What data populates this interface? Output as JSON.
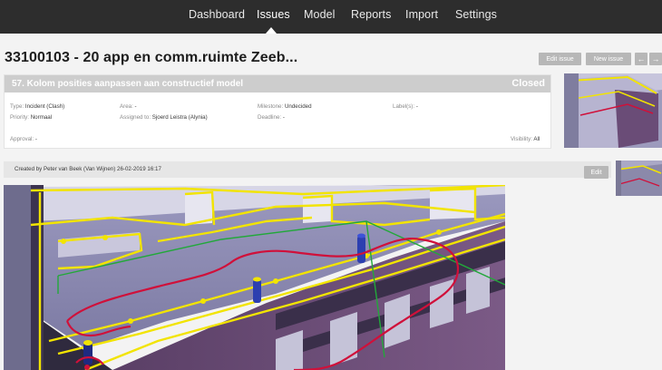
{
  "nav": {
    "items": [
      {
        "label": "Dashboard"
      },
      {
        "label": "Issues"
      },
      {
        "label": "Model"
      },
      {
        "label": "Reports"
      },
      {
        "label": "Import"
      },
      {
        "label": "Settings"
      }
    ]
  },
  "project": {
    "title": "33100103 - 20 app en comm.ruimte Zeeb..."
  },
  "toolbar": {
    "edit_issue": "Edit issue",
    "new_issue": "New issue",
    "prev_icon": "←",
    "next_icon": "→"
  },
  "issue": {
    "title": "57.  Kolom posities aanpassen aan constructief model",
    "status": "Closed",
    "fields": {
      "type_label": "Type:",
      "type_value": "Incident (Clash)",
      "priority_label": "Priority:",
      "priority_value": "Normaal",
      "area_label": "Area:",
      "area_value": "-",
      "assigned_label": "Assigned to:",
      "assigned_value": "Sjoerd Leistra (Alynia)",
      "milestone_label": "Milestone:",
      "milestone_value": "Undecided",
      "deadline_label": "Deadline:",
      "deadline_value": "-",
      "labels_label": "Label(s):",
      "labels_value": "-",
      "approval_label": "Approval:",
      "approval_value": "-",
      "visibility_label": "Visibility:",
      "visibility_value": "All"
    }
  },
  "comment": {
    "created_by": "Created by Peter van Beek (Van Wijnen) 26-02-2019 16:17",
    "edit_label": "Edit"
  },
  "colors": {
    "nav_bg": "#2d2d2d",
    "issue_header": "#cdcdcd",
    "button": "#b7b7b7",
    "accent_yellow": "#f2e400",
    "markup_red": "#d0103a",
    "markup_green": "#22a83a"
  }
}
